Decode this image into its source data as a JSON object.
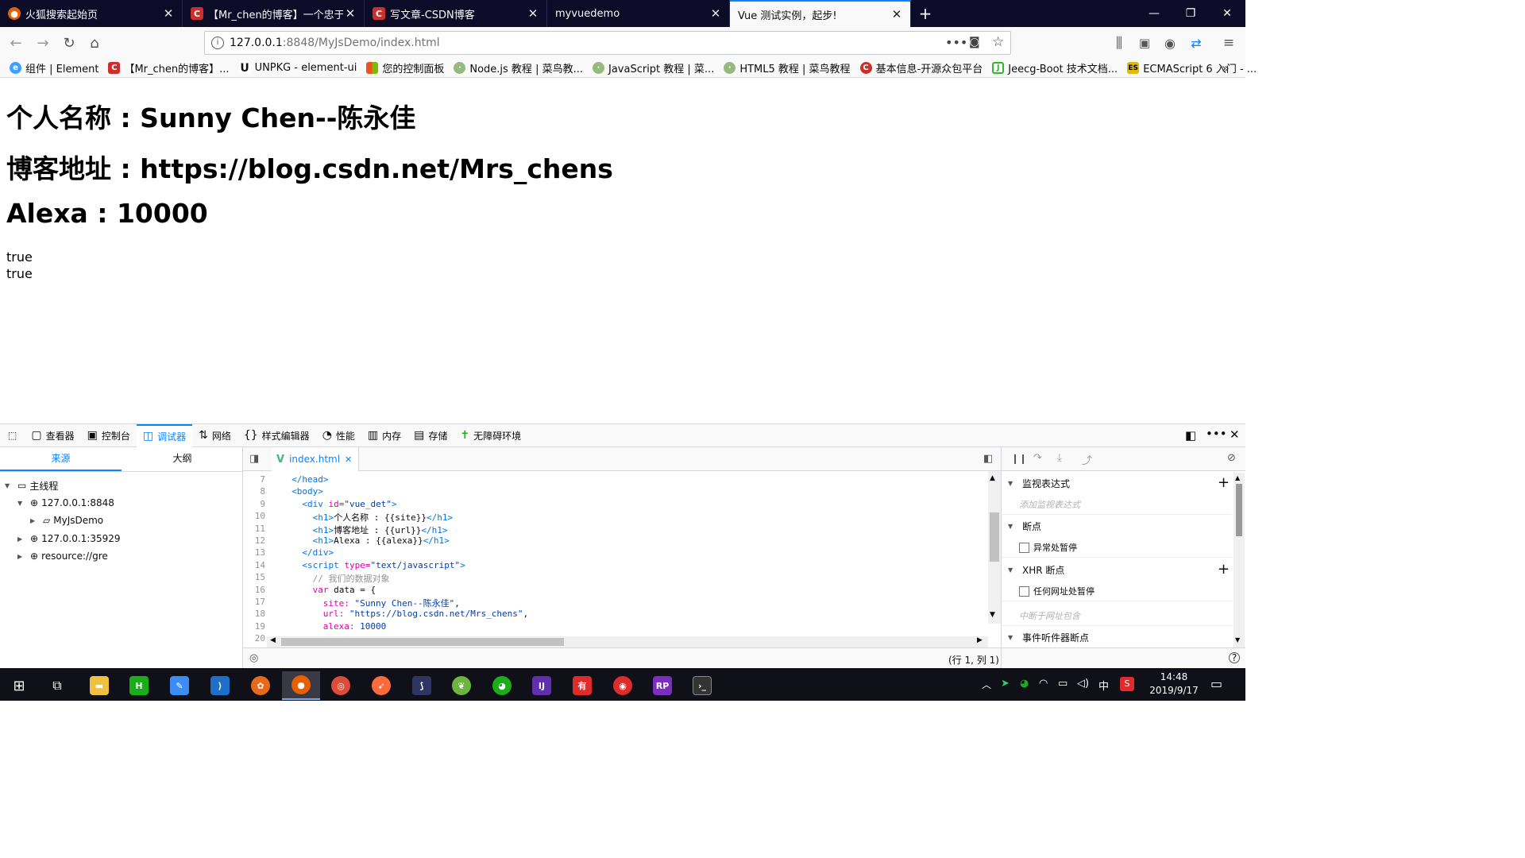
{
  "tabs": [
    {
      "title": "火狐搜索起始页",
      "icon": "firefox-icon",
      "color": "#e66000"
    },
    {
      "title": "【Mr_chen的博客】一个忠于",
      "icon": "csdn-icon",
      "color": "#c9302c"
    },
    {
      "title": "写文章-CSDN博客",
      "icon": "csdn-icon",
      "color": "#c9302c"
    },
    {
      "title": "myvuedemo",
      "icon": "",
      "color": ""
    },
    {
      "title": "Vue 测试实例，起步!",
      "icon": "",
      "color": ""
    }
  ],
  "url": {
    "host": "127.0.0.1",
    "rest": ":8848/MyJsDemo/index.html"
  },
  "bookmarks": [
    {
      "label": "组件 | Element",
      "icon": "element-icon",
      "color": "#409eff"
    },
    {
      "label": "【Mr_chen的博客】...",
      "icon": "csdn-icon",
      "color": "#c9302c"
    },
    {
      "label": "UNPKG - element-ui",
      "icon": "unpkg-icon",
      "color": "#222222"
    },
    {
      "label": "您的控制面板",
      "icon": "windows-icon",
      "color": "#f25022"
    },
    {
      "label": "Node.js 教程 | 菜鸟教...",
      "icon": "runoob-icon",
      "color": "#96b97d"
    },
    {
      "label": "JavaScript 教程 | 菜...",
      "icon": "runoob-icon",
      "color": "#96b97d"
    },
    {
      "label": "HTML5 教程 | 菜鸟教程",
      "icon": "runoob-icon",
      "color": "#96b97d"
    },
    {
      "label": "基本信息-开源众包平台",
      "icon": "oschina-icon",
      "color": "#c9302c"
    },
    {
      "label": "Jeecg-Boot 技术文档...",
      "icon": "jeecg-icon",
      "color": "#2eb82e"
    },
    {
      "label": "ECMAScript 6 入门 - ...",
      "icon": "es-icon",
      "color": "#e2b70e"
    }
  ],
  "page": {
    "h1_site": "个人名称 : Sunny Chen--陈永佳",
    "h1_url": "博客地址 : https://blog.csdn.net/Mrs_chens",
    "h1_alexa": "Alexa : 10000",
    "line1": "true",
    "line2": "true"
  },
  "devtools": {
    "tabs": [
      {
        "label": "查看器",
        "icon": "inspector-icon"
      },
      {
        "label": "控制台",
        "icon": "console-icon"
      },
      {
        "label": "调试器",
        "icon": "debugger-icon",
        "active": true
      },
      {
        "label": "网络",
        "icon": "network-icon"
      },
      {
        "label": "样式编辑器",
        "icon": "style-editor-icon"
      },
      {
        "label": "性能",
        "icon": "performance-icon"
      },
      {
        "label": "内存",
        "icon": "memory-icon"
      },
      {
        "label": "存储",
        "icon": "storage-icon"
      },
      {
        "label": "无障碍环境",
        "icon": "accessibility-icon"
      }
    ],
    "source_tab": "来源",
    "outline_tab": "大纲",
    "tree": {
      "main_thread": "主线程",
      "host1": "127.0.0.1:8848",
      "folder": "MyJsDemo",
      "host2": "127.0.0.1:35929",
      "resource": "resource://gre"
    },
    "file_tab": "index.html",
    "code": [
      {
        "n": "7",
        "indent": 2,
        "parts": [
          [
            "tg",
            "</head>"
          ]
        ]
      },
      {
        "n": "8",
        "indent": 2,
        "parts": [
          [
            "tg",
            "<body>"
          ]
        ]
      },
      {
        "n": "9",
        "indent": 4,
        "parts": [
          [
            "tg",
            "<div "
          ],
          [
            "at",
            "id="
          ],
          [
            "st",
            "\"vue_det\""
          ],
          [
            "tg",
            ">"
          ]
        ]
      },
      {
        "n": "10",
        "indent": 6,
        "parts": [
          [
            "tg",
            "<h1>"
          ],
          [
            "tx",
            "个人名称 : {{site}}"
          ],
          [
            "tg",
            "</h1>"
          ]
        ]
      },
      {
        "n": "11",
        "indent": 6,
        "parts": [
          [
            "tg",
            "<h1>"
          ],
          [
            "tx",
            "博客地址 : {{url}}"
          ],
          [
            "tg",
            "</h1>"
          ]
        ]
      },
      {
        "n": "12",
        "indent": 6,
        "parts": [
          [
            "tg",
            "<h1>"
          ],
          [
            "tx",
            "Alexa : {{alexa}}"
          ],
          [
            "tg",
            "</h1>"
          ]
        ]
      },
      {
        "n": "13",
        "indent": 4,
        "parts": [
          [
            "tg",
            "</div>"
          ]
        ]
      },
      {
        "n": "14",
        "indent": 4,
        "parts": [
          [
            "tg",
            "<script "
          ],
          [
            "at",
            "type="
          ],
          [
            "st",
            "\"text/javascript\""
          ],
          [
            "tg",
            ">"
          ]
        ]
      },
      {
        "n": "15",
        "indent": 6,
        "parts": [
          [
            "cm",
            "// 我们的数据对象"
          ]
        ]
      },
      {
        "n": "16",
        "indent": 6,
        "parts": [
          [
            "kw",
            "var "
          ],
          [
            "tx",
            "data = {"
          ]
        ]
      },
      {
        "n": "17",
        "indent": 8,
        "parts": [
          [
            "at",
            "site: "
          ],
          [
            "st",
            "\"Sunny Chen--陈永佳\""
          ],
          [
            "tx",
            ","
          ]
        ]
      },
      {
        "n": "18",
        "indent": 8,
        "parts": [
          [
            "at",
            "url: "
          ],
          [
            "st",
            "\"https://blog.csdn.net/Mrs_chens\""
          ],
          [
            "tx",
            ","
          ]
        ]
      },
      {
        "n": "19",
        "indent": 8,
        "parts": [
          [
            "at",
            "alexa: "
          ],
          [
            "st",
            "10000"
          ]
        ]
      },
      {
        "n": "20",
        "indent": 0,
        "parts": []
      }
    ],
    "cursor_pos": "(行 1, 列 1)",
    "watch": "监视表达式",
    "watch_placeholder": "添加监视表达式",
    "breakpoints": "断点",
    "pause_exceptions": "异常处暂停",
    "xhr_breakpoints": "XHR 断点",
    "pause_any_url": "任何网址处暂停",
    "xhr_placeholder": "中断于网址包含",
    "event_listener_bp": "事件听件器断点"
  },
  "taskbar": {
    "time": "14:48",
    "date": "2019/9/17",
    "ime": "中"
  }
}
